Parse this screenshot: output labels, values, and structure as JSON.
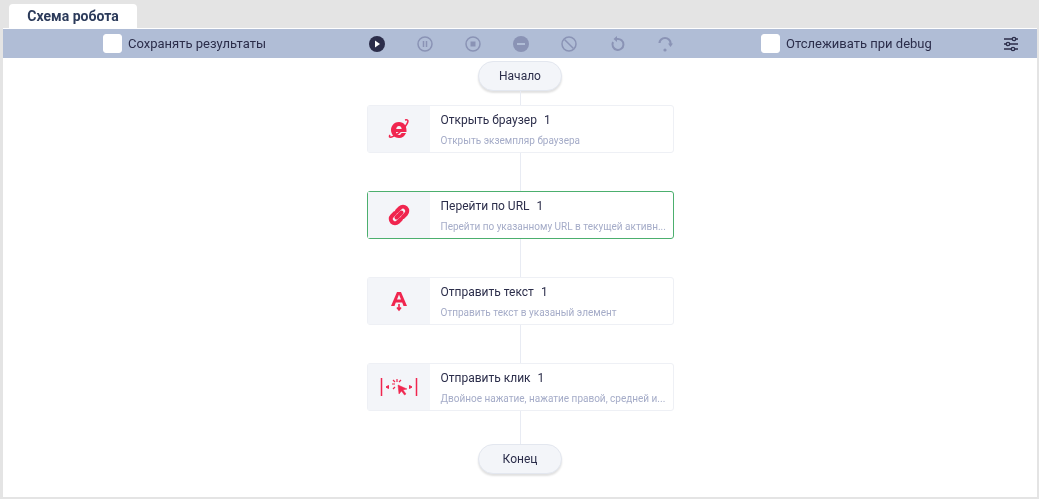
{
  "tabs": [
    {
      "label": "Схема робота",
      "selected": true
    }
  ],
  "toolbar": {
    "save_results": {
      "label": "Сохранять результаты",
      "checked": false
    },
    "controls": [
      {
        "kind": "play",
        "disabled": false
      },
      {
        "kind": "pause",
        "disabled": true
      },
      {
        "kind": "stop",
        "disabled": true
      },
      {
        "kind": "minus",
        "disabled": true
      },
      {
        "kind": "block",
        "disabled": true
      },
      {
        "kind": "restart",
        "disabled": true
      },
      {
        "kind": "step",
        "disabled": true
      }
    ],
    "debug_tracking": {
      "label": "Отслеживать при debug",
      "checked": false
    }
  },
  "flow": {
    "start": "Начало",
    "steps": [
      {
        "kind": "browser",
        "title": "Открыть браузер",
        "count": "1",
        "description": "Открыть экземпляр браузера",
        "selected": false
      },
      {
        "kind": "link",
        "title": "Перейти по URL",
        "count": "1",
        "description": "Перейти по указанному URL в текущей активн...",
        "selected": true
      },
      {
        "kind": "text",
        "title": "Отправить текст",
        "count": "1",
        "description": "Отправить текст в указаный элемент",
        "selected": false
      },
      {
        "kind": "click",
        "title": "Отправить клик",
        "count": "1",
        "description": "Двойное нажатие, нажатие правой, средней и...",
        "selected": false
      }
    ],
    "end": "Конец"
  }
}
